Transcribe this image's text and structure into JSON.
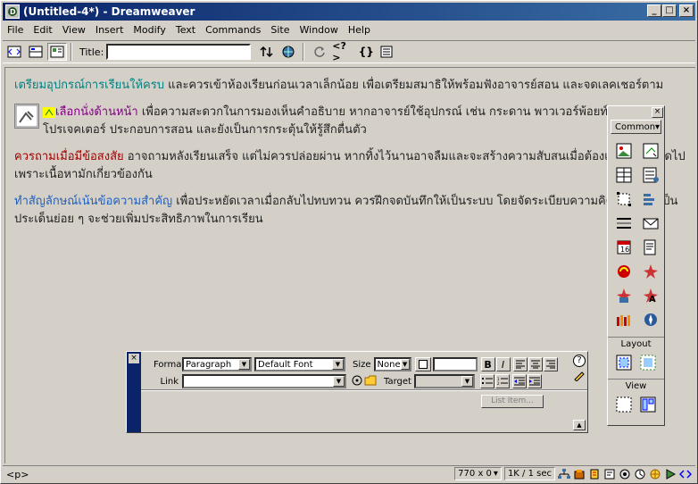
{
  "window": {
    "title": "(Untitled-4*) - Dreamweaver",
    "min_label": "_",
    "max_label": "□",
    "close_label": "×"
  },
  "menu": [
    "File",
    "Edit",
    "View",
    "Insert",
    "Modify",
    "Text",
    "Commands",
    "Site",
    "Window",
    "Help"
  ],
  "toolbar": {
    "title_label": "Title:",
    "title_value": "",
    "code_icon": "<>",
    "reference_icon": "<?>",
    "braces_icon": "{}"
  },
  "document": {
    "p1_head": "เตรียมอุปกรณ์การเรียนให้ครบ",
    "p1_text": " และควรเข้าห้องเรียนก่อนเวลาเล็กน้อย เพื่อเตรียมสมาธิให้พร้อมฟังอาจารย์สอน และจดเลคเชอร์ตาม",
    "p2_head": "เลือกนั่งด้านหน้า",
    "p2_text": " เพื่อความสะดวกในการมองเห็นคำอธิบาย หากอาจารย์ใช้อุปกรณ์ เช่น กระดาน พาวเวอร์พ้อยท์ หรือโปรเจคเตอร์ ประกอบการสอน และยังเป็นการกระตุ้นให้รู้สึกตื่นตัว",
    "p3_head": "ควรถามเมื่อมีข้อสงสัย",
    "p3_text": " อาจถามหลังเรียนเสร็จ แต่ไม่ควรปล่อยผ่าน หากทิ้งไว้นานอาจลืมและจะสร้างความสับสนเมื่อต้องเรียนในวันถัดไป เพราะเนื้อหามักเกี่ยวข้องกัน",
    "p4_head": "ทำสัญลักษณ์เน้นข้อความสำคัญ",
    "p4_text": " เพื่อประหยัดเวลาเมื่อกลับไปทบทวน ควรฝึกจดบันทึกให้เป็นระบบ โดยจัดระเบียบความคิด และสรุปเป็นประเด็นย่อย ๆ จะช่วยเพิ่มประสิทธิภาพในการเรียน"
  },
  "objects_panel": {
    "category": "Common",
    "layout_label": "Layout",
    "view_label": "View"
  },
  "properties": {
    "format_label": "Format",
    "format_value": "Paragraph",
    "font_value": "Default Font",
    "size_label": "Size",
    "size_value": "None",
    "link_label": "Link",
    "link_value": "",
    "target_label": "Target",
    "bold": "B",
    "italic": "I",
    "list_item": "List Item...",
    "help": "?"
  },
  "status": {
    "tag": "<p>",
    "window_size": "770 x 0",
    "download": "1K / 1 sec"
  }
}
